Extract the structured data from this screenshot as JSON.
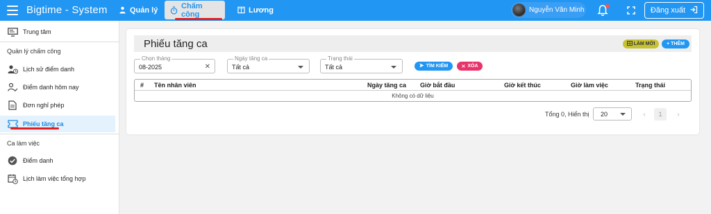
{
  "app": {
    "title": "Bigtime - System"
  },
  "topnav": {
    "items": [
      {
        "label": "Quản lý",
        "icon": "people-icon"
      },
      {
        "label": "Chấm công",
        "icon": "stopwatch-icon",
        "active": true
      },
      {
        "label": "Lương",
        "icon": "ledger-icon"
      }
    ]
  },
  "user": {
    "name": "Nguyễn Văn Minh"
  },
  "header_actions": {
    "logout_label": "Đăng xuất"
  },
  "sidebar": {
    "top_items": [
      {
        "label": "Trung tâm",
        "icon": "monitor-icon"
      }
    ],
    "sections": [
      {
        "title": "Quản lý chấm công",
        "items": [
          {
            "label": "Lịch sử điểm danh",
            "icon": "person-history-icon"
          },
          {
            "label": "Điểm danh hôm nay",
            "icon": "person-check-icon"
          },
          {
            "label": "Đơn nghỉ phép",
            "icon": "document-icon"
          },
          {
            "label": "Phiếu tăng ca",
            "icon": "ticket-icon",
            "active": true
          }
        ]
      },
      {
        "title": "Ca làm việc",
        "items": [
          {
            "label": "Điểm danh",
            "icon": "check-circle-icon"
          },
          {
            "label": "Lịch làm việc tổng hợp",
            "icon": "calendar-clock-icon"
          }
        ]
      }
    ]
  },
  "page": {
    "title": "Phiếu tăng ca",
    "refresh_label": "Làm mới",
    "add_label": "+ Thêm",
    "filters": {
      "month": {
        "label": "Chọn tháng",
        "value": "08-2025"
      },
      "date": {
        "label": "Ngày tăng ca",
        "value": "Tất cả"
      },
      "status": {
        "label": "Trạng thái",
        "value": "Tất cả"
      }
    },
    "search_label": "Tìm kiếm",
    "clear_label": "Xóa",
    "table": {
      "columns": [
        "#",
        "Tên nhân viên",
        "Ngày tăng ca",
        "Giờ bắt đầu",
        "Giờ kết thúc",
        "Giờ làm việc",
        "Trạng thái"
      ],
      "empty_text": "Không có dữ liệu"
    },
    "pagination": {
      "summary": "Tổng 0,  Hiển thị",
      "per_page": "20",
      "current_page": "1"
    }
  },
  "colors": {
    "primary": "#2196f3",
    "danger": "#e8346a",
    "refresh": "#c6c234"
  }
}
